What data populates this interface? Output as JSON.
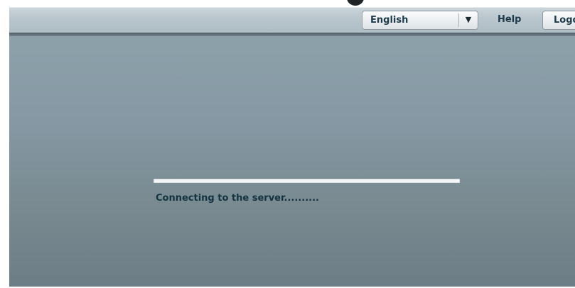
{
  "header": {
    "language_selected": "English",
    "help_label": "Help",
    "logout_label": "Logout"
  },
  "main": {
    "progress_fraction": 1.0,
    "status_text": "Connecting to the server.........."
  },
  "icons": {
    "dropdown": "chevron-down-icon"
  },
  "colors": {
    "header": "#b9c6cd",
    "main_background": "#8598a3",
    "progress_fill": "#f4f6f7",
    "status_text": "#12333f"
  }
}
